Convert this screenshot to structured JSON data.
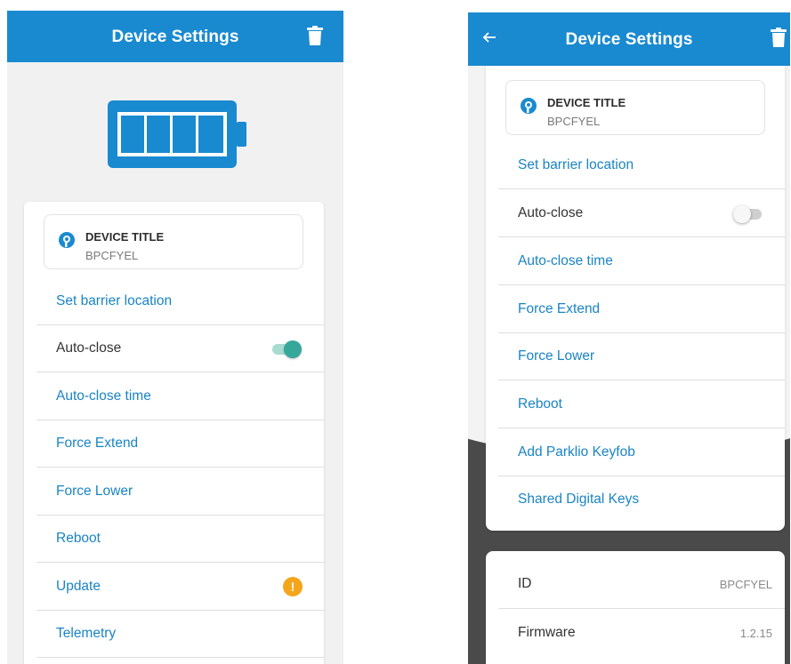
{
  "left_screen": {
    "header": {
      "title": "Device Settings",
      "delete_icon": "trash-icon"
    },
    "battery": {
      "icon": "battery-icon",
      "level": 1.0
    },
    "device": {
      "title": "DEVICE TITLE",
      "subtitle": "BPCFYEL",
      "logo_icon": "parklio-logo-icon"
    },
    "items": [
      {
        "label": "Set barrier location",
        "style": "link"
      },
      {
        "label": "Auto-close",
        "style": "plain",
        "toggle": true
      },
      {
        "label": "Auto-close time",
        "style": "link"
      },
      {
        "label": "Force Extend",
        "style": "link"
      },
      {
        "label": "Force Lower",
        "style": "link"
      },
      {
        "label": "Reboot",
        "style": "link"
      },
      {
        "label": "Update",
        "style": "link",
        "badge": "!"
      },
      {
        "label": "Telemetry",
        "style": "link"
      }
    ]
  },
  "right_screen": {
    "header": {
      "title": "Device Settings",
      "back_icon": "arrow-left-icon",
      "delete_icon": "trash-icon"
    },
    "device": {
      "title": "DEVICE TITLE",
      "subtitle": "BPCFYEL",
      "logo_icon": "parklio-logo-icon"
    },
    "items": [
      {
        "label": "Set barrier location",
        "style": "link"
      },
      {
        "label": "Auto-close",
        "style": "plain",
        "toggle": false
      },
      {
        "label": "Auto-close time",
        "style": "link"
      },
      {
        "label": "Force Extend",
        "style": "link"
      },
      {
        "label": "Force Lower",
        "style": "link"
      },
      {
        "label": "Reboot",
        "style": "link"
      },
      {
        "label": "Add Parklio Keyfob",
        "style": "link"
      },
      {
        "label": "Shared Digital Keys",
        "style": "link"
      }
    ],
    "info": [
      {
        "label": "ID",
        "value": "BPCFYEL"
      },
      {
        "label": "Firmware",
        "value": "1.2.15"
      }
    ]
  },
  "colors": {
    "primary": "#1a8ad0",
    "link": "#1a84c4",
    "toggle_on": "#35a89a",
    "warning": "#f5a51c"
  }
}
